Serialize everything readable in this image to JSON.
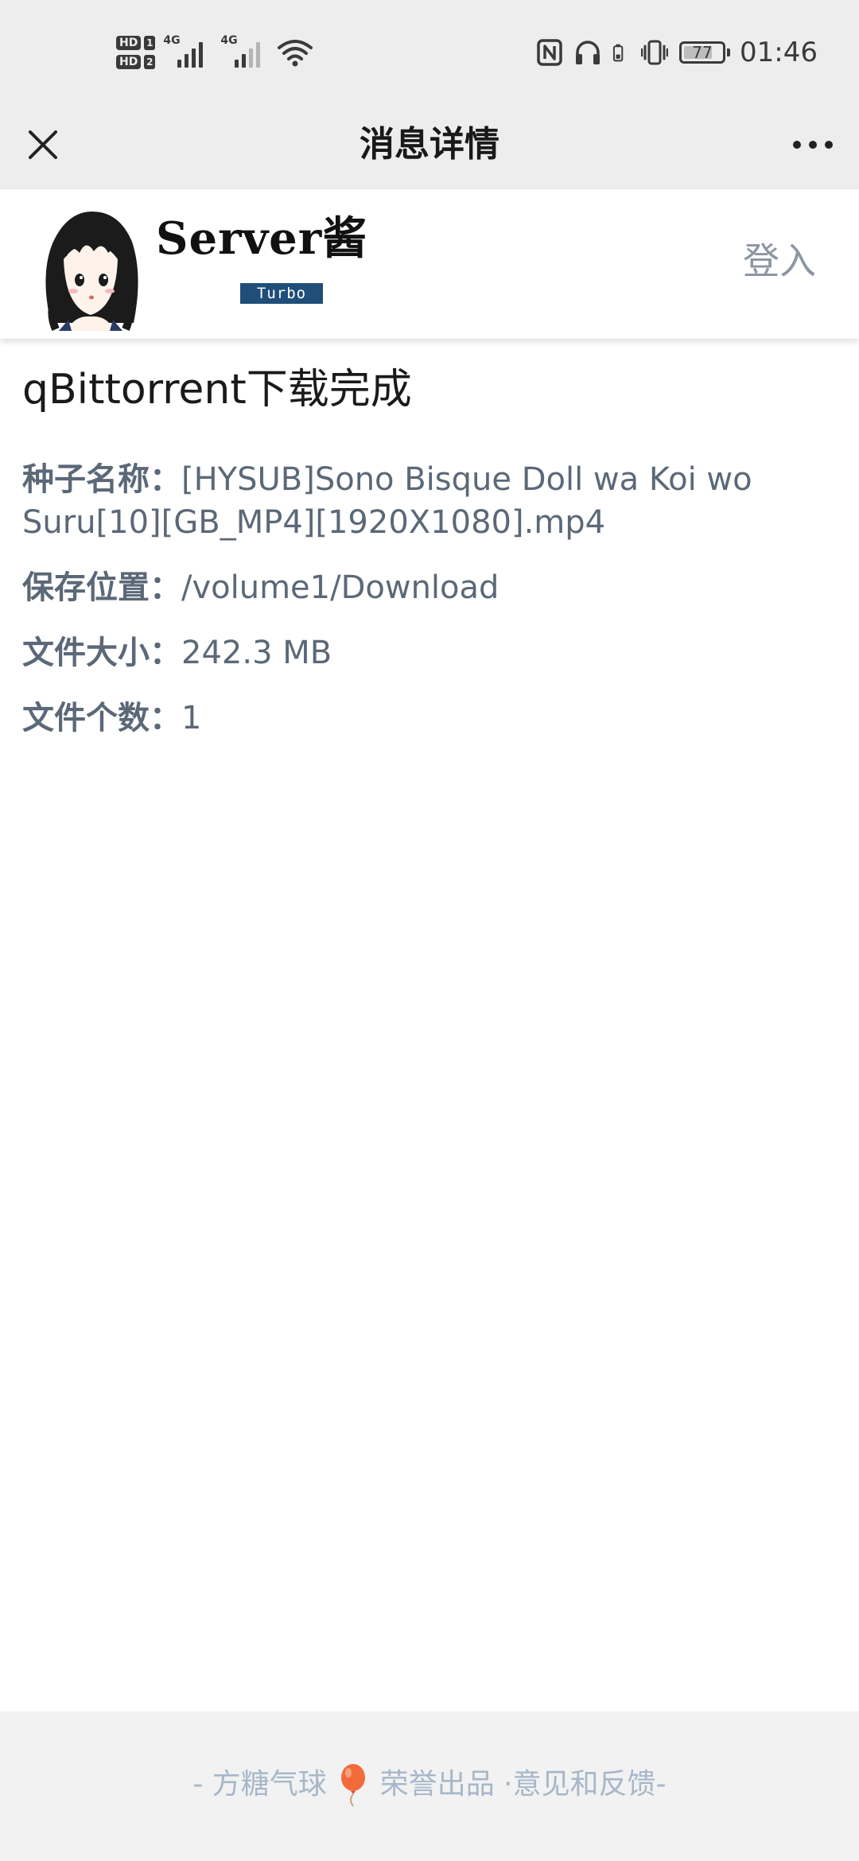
{
  "status_bar": {
    "hd_badge": "HD",
    "sim1": "1",
    "sim2": "2",
    "network1": "4G",
    "network2": "4G",
    "battery_percent": "77",
    "battery_level": 0.77,
    "time": "01:46"
  },
  "nav": {
    "title": "消息详情"
  },
  "brand": {
    "name": "Server酱",
    "badge": "Turbo",
    "login": "登入"
  },
  "message": {
    "title": "qBittorrent下载完成",
    "fields": [
      {
        "label": "种子名称：",
        "value": "[HYSUB]Sono Bisque Doll wa Koi wo Suru[10][GB_MP4][1920X1080].mp4"
      },
      {
        "label": "保存位置：",
        "value": "/volume1/Download"
      },
      {
        "label": "文件大小：",
        "value": "242.3 MB"
      },
      {
        "label": "文件个数：",
        "value": "1"
      }
    ]
  },
  "footer": {
    "prefix": "- 方糖气球",
    "honor": "荣誉出品",
    "separator": " ·",
    "feedback": "意见和反馈",
    "suffix": "-"
  },
  "colors": {
    "header_bg": "#ededed",
    "label_text": "#5b6877",
    "login_text": "#8c96a3",
    "badge_bg": "#1f4e79",
    "footer_text": "#a6b7c9",
    "footer_bg": "#f2f2f2"
  }
}
